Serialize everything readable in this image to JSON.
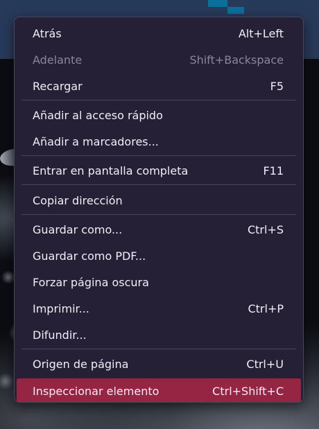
{
  "menu": {
    "items": [
      {
        "label": "Atrás",
        "shortcut": "Alt+Left"
      },
      {
        "label": "Adelante",
        "shortcut": "Shift+Backspace",
        "disabled": true
      },
      {
        "label": "Recargar",
        "shortcut": "F5"
      },
      {
        "label": "Añadir al acceso rápido",
        "shortcut": ""
      },
      {
        "label": "Añadir a marcadores...",
        "shortcut": ""
      },
      {
        "label": "Entrar en pantalla completa",
        "shortcut": "F11"
      },
      {
        "label": "Copiar dirección",
        "shortcut": ""
      },
      {
        "label": "Guardar como...",
        "shortcut": "Ctrl+S"
      },
      {
        "label": "Guardar como PDF...",
        "shortcut": ""
      },
      {
        "label": "Forzar página oscura",
        "shortcut": ""
      },
      {
        "label": "Imprimir...",
        "shortcut": "Ctrl+P"
      },
      {
        "label": "Difundir...",
        "shortcut": ""
      },
      {
        "label": "Origen de página",
        "shortcut": "Ctrl+U"
      },
      {
        "label": "Inspeccionar elemento",
        "shortcut": "Ctrl+Shift+C",
        "highlighted": true
      }
    ]
  },
  "colors": {
    "menu_background": "#252035",
    "highlight": "#952543",
    "text": "#f0eef6",
    "disabled_text": "#8b8796",
    "separator": "#4b4658"
  }
}
